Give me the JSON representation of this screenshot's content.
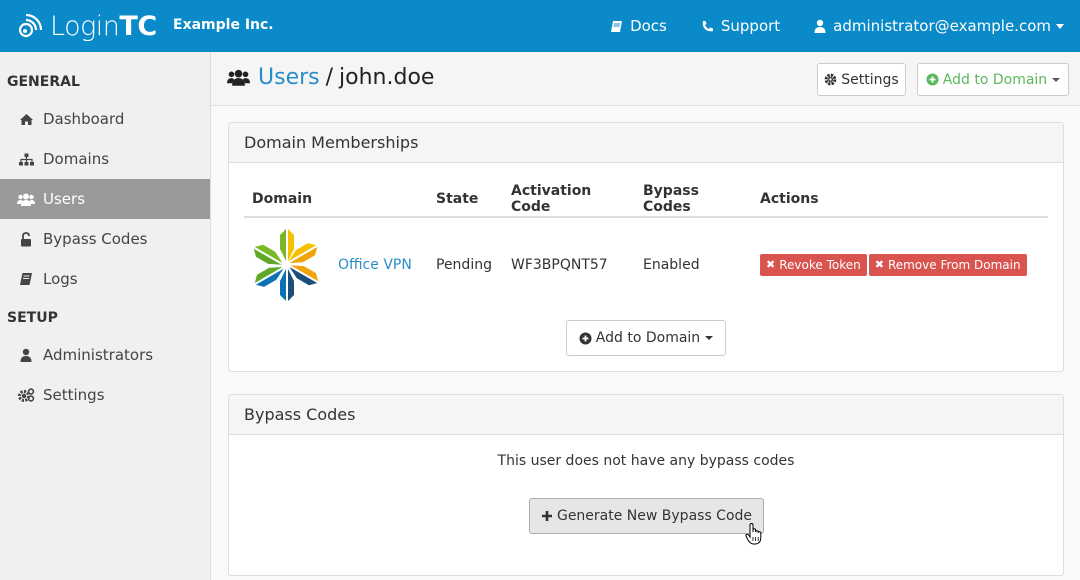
{
  "topbar": {
    "brand_light": "Login",
    "brand_bold": "TC",
    "org_name": "Example Inc.",
    "nav": {
      "docs": "Docs",
      "support": "Support",
      "account": "administrator@example.com"
    },
    "colors": {
      "background": "#0a8ac9"
    }
  },
  "sidebar": {
    "sections": [
      {
        "title": "GENERAL",
        "items": [
          {
            "label": "Dashboard",
            "icon": "home-icon",
            "active": false
          },
          {
            "label": "Domains",
            "icon": "sitemap-icon",
            "active": false
          },
          {
            "label": "Users",
            "icon": "users-icon",
            "active": true
          },
          {
            "label": "Bypass Codes",
            "icon": "unlock-icon",
            "active": false
          },
          {
            "label": "Logs",
            "icon": "book-icon",
            "active": false
          }
        ]
      },
      {
        "title": "SETUP",
        "items": [
          {
            "label": "Administrators",
            "icon": "user-icon",
            "active": false
          },
          {
            "label": "Settings",
            "icon": "gears-icon",
            "active": false
          }
        ]
      }
    ]
  },
  "header": {
    "breadcrumb_link": "Users",
    "separator": "/",
    "current": "john.doe",
    "settings_label": "Settings",
    "add_to_domain_label": "Add to Domain"
  },
  "domain_memberships": {
    "title": "Domain Memberships",
    "columns": [
      "Domain",
      "State",
      "Activation Code",
      "Bypass Codes",
      "Actions"
    ],
    "rows": [
      {
        "domain": "Office VPN",
        "state": "Pending",
        "activation_code": "WF3BPQNT57",
        "bypass_codes": "Enabled",
        "actions": [
          "Revoke Token",
          "Remove From Domain"
        ]
      }
    ],
    "add_button_label": "Add to Domain"
  },
  "bypass_codes": {
    "title": "Bypass Codes",
    "empty_message": "This user does not have any bypass codes",
    "generate_label": "Generate New Bypass Code"
  }
}
